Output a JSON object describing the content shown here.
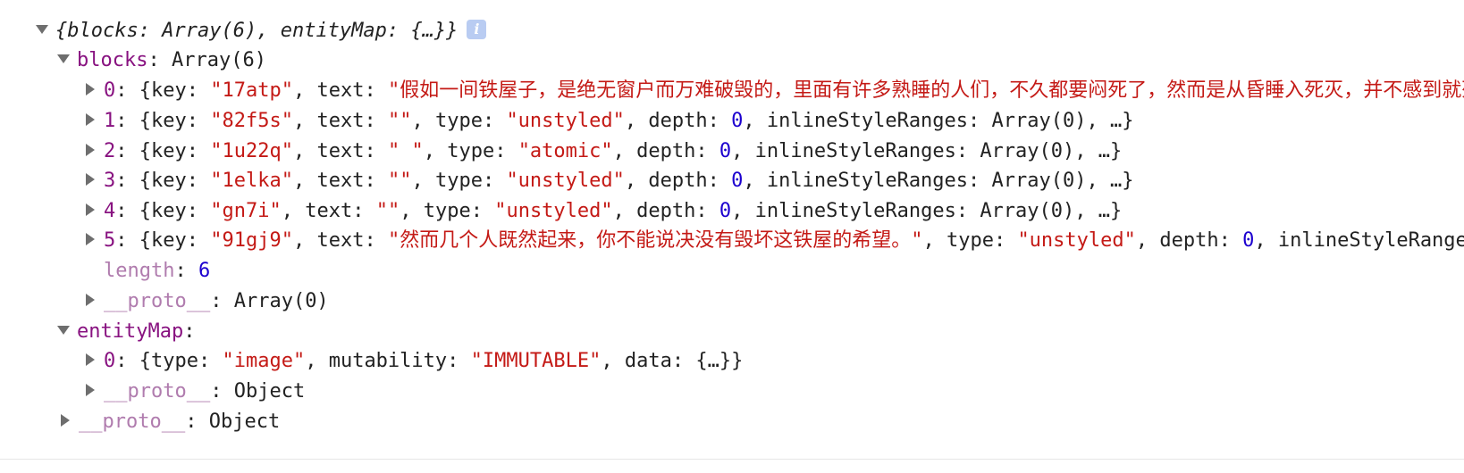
{
  "root": {
    "summary_open": "{",
    "summary_k1": "blocks",
    "summary_v1": "Array(6)",
    "summary_k2": "entityMap",
    "summary_v2": "{…}",
    "summary_close": "}",
    "info_icon_label": "i"
  },
  "blocks": {
    "label": "blocks",
    "type": "Array(6)",
    "items": [
      {
        "index": "0",
        "key": "\"17atp\"",
        "text": "\"假如一间铁屋子，是绝无窗户而万难破毁的，里面有许多熟睡的人们，不久都要闷死了，然而是从昏睡入死灭，并不感到就死的悲哀。\""
      },
      {
        "index": "1",
        "key": "\"82f5s\"",
        "text": "\"\"",
        "type": "\"unstyled\"",
        "depth": "0",
        "isr": "Array(0)"
      },
      {
        "index": "2",
        "key": "\"1u22q\"",
        "text": "\" \"",
        "type": "\"atomic\"",
        "depth": "0",
        "isr": "Array(0)"
      },
      {
        "index": "3",
        "key": "\"1elka\"",
        "text": "\"\"",
        "type": "\"unstyled\"",
        "depth": "0",
        "isr": "Array(0)"
      },
      {
        "index": "4",
        "key": "\"gn7i\"",
        "text": "\"\"",
        "type": "\"unstyled\"",
        "depth": "0",
        "isr": "Array(0)"
      },
      {
        "index": "5",
        "key": "\"91gj9\"",
        "text": "\"然而几个人既然起来，你不能说决没有毁坏这铁屋的希望。\"",
        "type": "\"unstyled\"",
        "depth": "0",
        "tail_key": "inlineStyleRanges"
      }
    ],
    "length_label": "length",
    "length_value": "6",
    "proto_label": "__proto__",
    "proto_value": "Array(0)"
  },
  "entityMap": {
    "label": "entityMap",
    "entry_index": "0",
    "entry_type": "\"image\"",
    "entry_mutability": "\"IMMUTABLE\"",
    "entry_data": "{…}",
    "proto_label": "__proto__",
    "proto_value": "Object"
  },
  "root_proto": {
    "label": "__proto__",
    "value": "Object"
  },
  "labels": {
    "key": "key",
    "text": "text",
    "type": "type",
    "depth": "depth",
    "isr": "inlineStyleRanges",
    "mutability": "mutability",
    "data": "data",
    "ellipsis": "…"
  }
}
